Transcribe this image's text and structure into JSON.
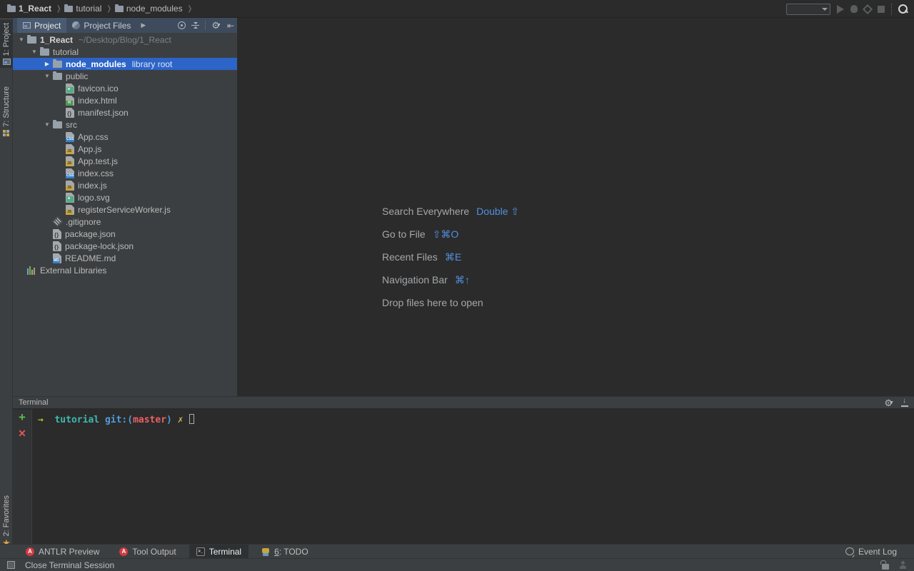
{
  "breadcrumbs": [
    "1_React",
    "tutorial",
    "node_modules"
  ],
  "run_controls": {
    "config_value": ""
  },
  "left_stripe": {
    "top": [
      {
        "label": "1: Project",
        "icon": "project-tool-icon",
        "active": true
      },
      {
        "label": "7: Structure",
        "icon": "structure-tool-icon",
        "active": false
      }
    ],
    "bottom": [
      {
        "label": "2: Favorites",
        "icon": "star-icon",
        "active": false
      }
    ]
  },
  "project_panel": {
    "tabs": [
      {
        "label": "Project",
        "selected": true,
        "icon": "project-tab-icon"
      },
      {
        "label": "Project Files",
        "selected": false,
        "icon": "pie-icon"
      }
    ],
    "tree": [
      {
        "indent": 0,
        "chevron": "down",
        "icon": "folder",
        "name": "1_React",
        "bold": true,
        "suffix": "~/Desktop/Blog/1_React"
      },
      {
        "indent": 1,
        "chevron": "down",
        "icon": "folder",
        "name": "tutorial"
      },
      {
        "indent": 2,
        "chevron": "right",
        "icon": "folder",
        "name": "node_modules",
        "suffix": "library root",
        "selected": true
      },
      {
        "indent": 2,
        "chevron": "down",
        "icon": "folder",
        "name": "public"
      },
      {
        "indent": 3,
        "chevron": null,
        "icon": "image",
        "name": "favicon.ico"
      },
      {
        "indent": 3,
        "chevron": null,
        "icon": "html",
        "name": "index.html"
      },
      {
        "indent": 3,
        "chevron": null,
        "icon": "json",
        "name": "manifest.json"
      },
      {
        "indent": 2,
        "chevron": "down",
        "icon": "folder",
        "name": "src"
      },
      {
        "indent": 3,
        "chevron": null,
        "icon": "css",
        "name": "App.css"
      },
      {
        "indent": 3,
        "chevron": null,
        "icon": "js",
        "name": "App.js"
      },
      {
        "indent": 3,
        "chevron": null,
        "icon": "js",
        "name": "App.test.js"
      },
      {
        "indent": 3,
        "chevron": null,
        "icon": "css",
        "name": "index.css"
      },
      {
        "indent": 3,
        "chevron": null,
        "icon": "js",
        "name": "index.js"
      },
      {
        "indent": 3,
        "chevron": null,
        "icon": "image",
        "name": "logo.svg"
      },
      {
        "indent": 3,
        "chevron": null,
        "icon": "js",
        "name": "registerServiceWorker.js"
      },
      {
        "indent": 2,
        "chevron": null,
        "icon": "git",
        "name": ".gitignore"
      },
      {
        "indent": 2,
        "chevron": null,
        "icon": "json",
        "name": "package.json"
      },
      {
        "indent": 2,
        "chevron": null,
        "icon": "json",
        "name": "package-lock.json"
      },
      {
        "indent": 2,
        "chevron": null,
        "icon": "md",
        "name": "README.md"
      },
      {
        "indent": 0,
        "chevron": null,
        "icon": "lib",
        "name": "External Libraries"
      }
    ]
  },
  "editor_shortcuts": [
    {
      "label": "Search Everywhere",
      "keys": "Double ⇧"
    },
    {
      "label": "Go to File",
      "keys": "⇧⌘O"
    },
    {
      "label": "Recent Files",
      "keys": "⌘E"
    },
    {
      "label": "Navigation Bar",
      "keys": "⌘↑"
    },
    {
      "label": "Drop files here to open",
      "keys": ""
    }
  ],
  "terminal": {
    "title": "Terminal",
    "prompt_segments": [
      {
        "text": "→",
        "color": "#b3be2a"
      },
      {
        "text": "  ",
        "color": ""
      },
      {
        "text": "tutorial ",
        "color": "#3fb9b0"
      },
      {
        "text": "git:(",
        "color": "#4f9cda"
      },
      {
        "text": "master",
        "color": "#ed5f65"
      },
      {
        "text": ") ",
        "color": "#4f9cda"
      },
      {
        "text": "✗ ",
        "color": "#cdb456"
      }
    ]
  },
  "tool_buttons": [
    {
      "label": "ANTLR Preview",
      "icon": "antlr-icon",
      "icon_letter": "A",
      "active": false,
      "underlined_prefix": ""
    },
    {
      "label": "Tool Output",
      "icon": "antlr-icon",
      "icon_letter": "A",
      "active": false,
      "underlined_prefix": ""
    },
    {
      "label": "Terminal",
      "icon": "terminal-icon",
      "icon_letter": ">_",
      "active": true,
      "underlined_prefix": ""
    },
    {
      "label": "6: TODO",
      "icon": "todo-icon",
      "icon_letter": "",
      "active": false,
      "underlined_prefix": "6"
    }
  ],
  "event_log_label": "Event Log",
  "status_bar": {
    "message": "Close Terminal Session"
  },
  "colors": {
    "selection_blue": "#2d64c8",
    "panel_header_blue": "#3e4b5c",
    "shortcut_key_blue": "#5290e0",
    "plus_green": "#5fb84b",
    "close_red": "#e05555",
    "antlr_red": "#d23b41"
  }
}
